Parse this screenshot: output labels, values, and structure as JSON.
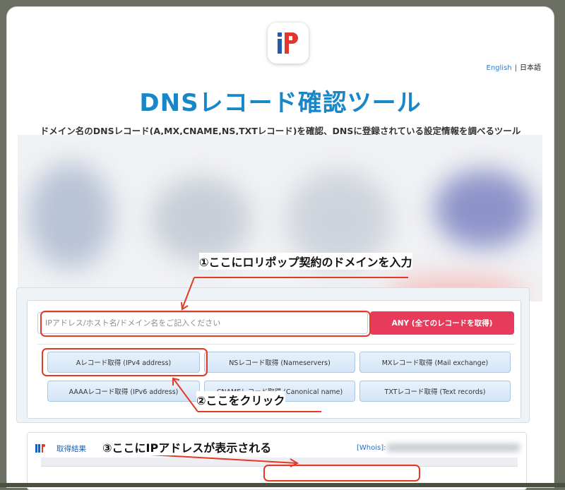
{
  "logo": {
    "text": "iP"
  },
  "language": {
    "english": "English",
    "separator": "|",
    "japanese": "日本語"
  },
  "page": {
    "title": "DNSレコード確認ツール",
    "subtitle": "ドメイン名のDNSレコード(A,MX,CNAME,NS,TXTレコード)を確認、DNSに登録されている設定情報を調べるツール"
  },
  "form": {
    "input_placeholder": "IPアドレス/ホスト名/ドメイン名をご記入ください",
    "any_button": "ANY (全てのレコードを取得)",
    "record_buttons": [
      "Aレコード取得 (IPv4 address)",
      "NSレコード取得 (Nameservers)",
      "MXレコード取得 (Mail exchange)",
      "AAAAレコード取得 (IPv6 address)",
      "CNAMEレコード取得 (Canonical name)",
      "TXTレコード取得 (Text records)"
    ]
  },
  "result": {
    "label": "取得結果",
    "whois": "[Whois]:"
  },
  "annotations": {
    "step1": "①ここにロリポップ契約のドメインを入力",
    "step2": "②ここをクリック",
    "step3": "③ここにIPアドレスが表示される"
  },
  "colors": {
    "title": "#1787c9",
    "any_button": "#e63b5a",
    "annotation_red": "#e43a24"
  }
}
